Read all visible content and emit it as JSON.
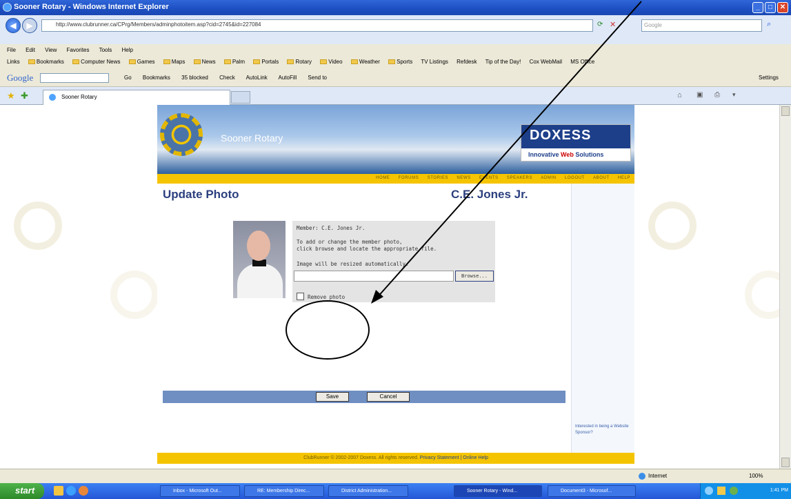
{
  "window": {
    "title": "Sooner Rotary - Windows Internet Explorer",
    "address": "http://www.clubrunner.ca/CPrg/Members/adminphotoitem.asp?cid=2745&id=227084",
    "search_placeholder": "Google",
    "tab_title": "Sooner Rotary",
    "menu": [
      "File",
      "Edit",
      "View",
      "Favorites",
      "Tools",
      "Help"
    ],
    "links_label": "Links",
    "links": [
      "Bookmarks",
      "Computer News",
      "Games",
      "Maps",
      "News",
      "Palm",
      "Portals",
      "Rotary",
      "Video",
      "Weather",
      "Sports",
      "TV Listings",
      "Refdesk",
      "Tip of the Day!",
      "Cox WebMail",
      "MS Office"
    ],
    "google_toolbar": [
      "Go",
      "Bookmarks",
      "35 blocked",
      "Check",
      "AutoLink",
      "AutoFill",
      "Send to",
      "Settings"
    ]
  },
  "site": {
    "club_name": "Sooner Rotary",
    "sponsor_logo": {
      "name": "DOXESS",
      "tagline_prefix": "Innovative",
      "tagline_bold": "Web",
      "tagline_suffix": "Solutions"
    },
    "nav": [
      "HOME",
      "FORUMS",
      "STORIES",
      "NEWS",
      "EVENTS",
      "SPEAKERS",
      "ADMIN",
      "LOGOUT",
      "ABOUT",
      "HELP"
    ],
    "page_title": "Update Photo",
    "member_heading": "C.E. Jones Jr.",
    "form": {
      "member_line": "Member: C.E. Jones Jr.",
      "instruction_1": "To add or change the member photo,",
      "instruction_2": "click browse and locate the appropriate file.",
      "resize_note": "Image will be resized automatically.",
      "browse_label": "Browse...",
      "remove_label": "Remove photo",
      "save_label": "Save",
      "cancel_label": "Cancel"
    },
    "sponsor_note": "Interested in being a Website Sponsor?",
    "footer_text": "ClubRunner © 2002-2007 Doxess. All rights reserved.",
    "footer_links": "Privacy Statement | Online Help"
  },
  "statusbar": {
    "zone": "Internet",
    "zoom": "100%"
  },
  "taskbar": {
    "start": "start",
    "tasks": [
      "Inbox - Microsoft Out...",
      "RE: Membership Direc...",
      "District Administration...",
      "Sooner Rotary - Wind...",
      "Document3 - Microsof..."
    ],
    "clock": "1:41 PM"
  }
}
